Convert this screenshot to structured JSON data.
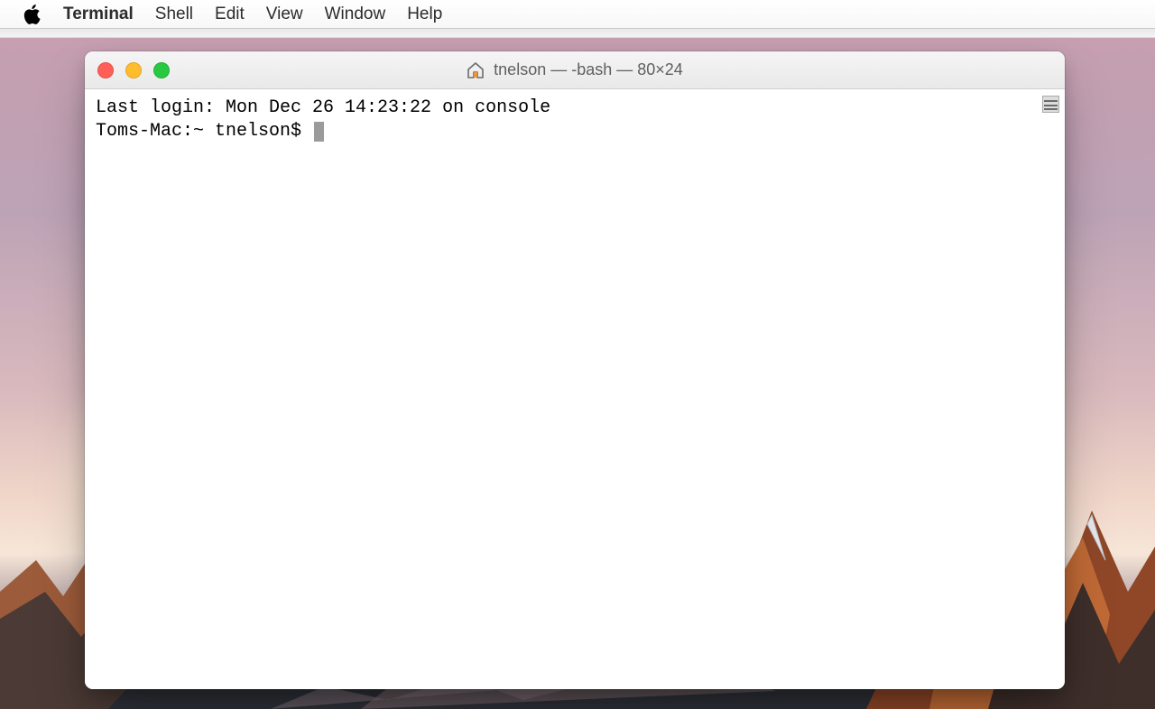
{
  "menubar": {
    "app_name": "Terminal",
    "items": [
      "Shell",
      "Edit",
      "View",
      "Window",
      "Help"
    ]
  },
  "window": {
    "title": "tnelson — -bash — 80×24",
    "traffic_lights": {
      "close_color": "#ff5f57",
      "minimize_color": "#ffbd2e",
      "zoom_color": "#28c840"
    }
  },
  "terminal": {
    "last_login_line": "Last login: Mon Dec 26 14:23:22 on console",
    "prompt": "Toms-Mac:~ tnelson$ "
  }
}
